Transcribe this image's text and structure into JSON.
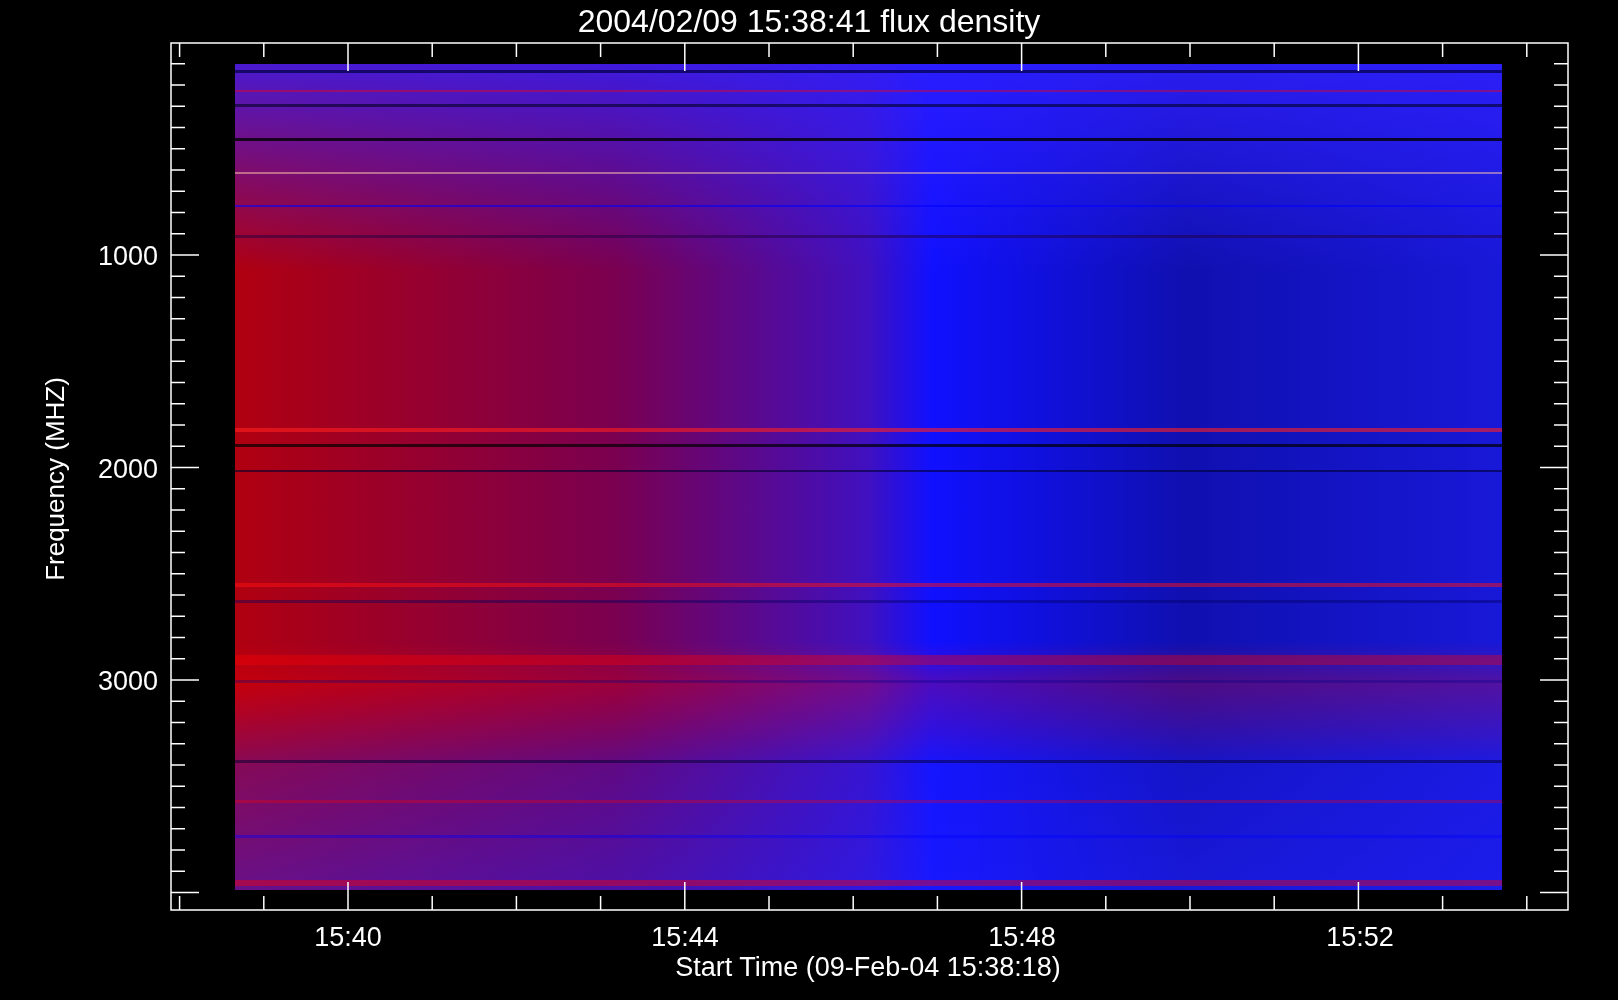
{
  "title": "2004/02/09 15:38:41 flux density",
  "y_axis": {
    "label": "Frequency (MHZ)",
    "tick_labels": [
      "1000",
      "2000",
      "3000"
    ]
  },
  "x_axis": {
    "label": "Start Time (09-Feb-04 15:38:18)",
    "tick_labels": [
      "15:40",
      "15:44",
      "15:48",
      "15:52"
    ]
  }
}
